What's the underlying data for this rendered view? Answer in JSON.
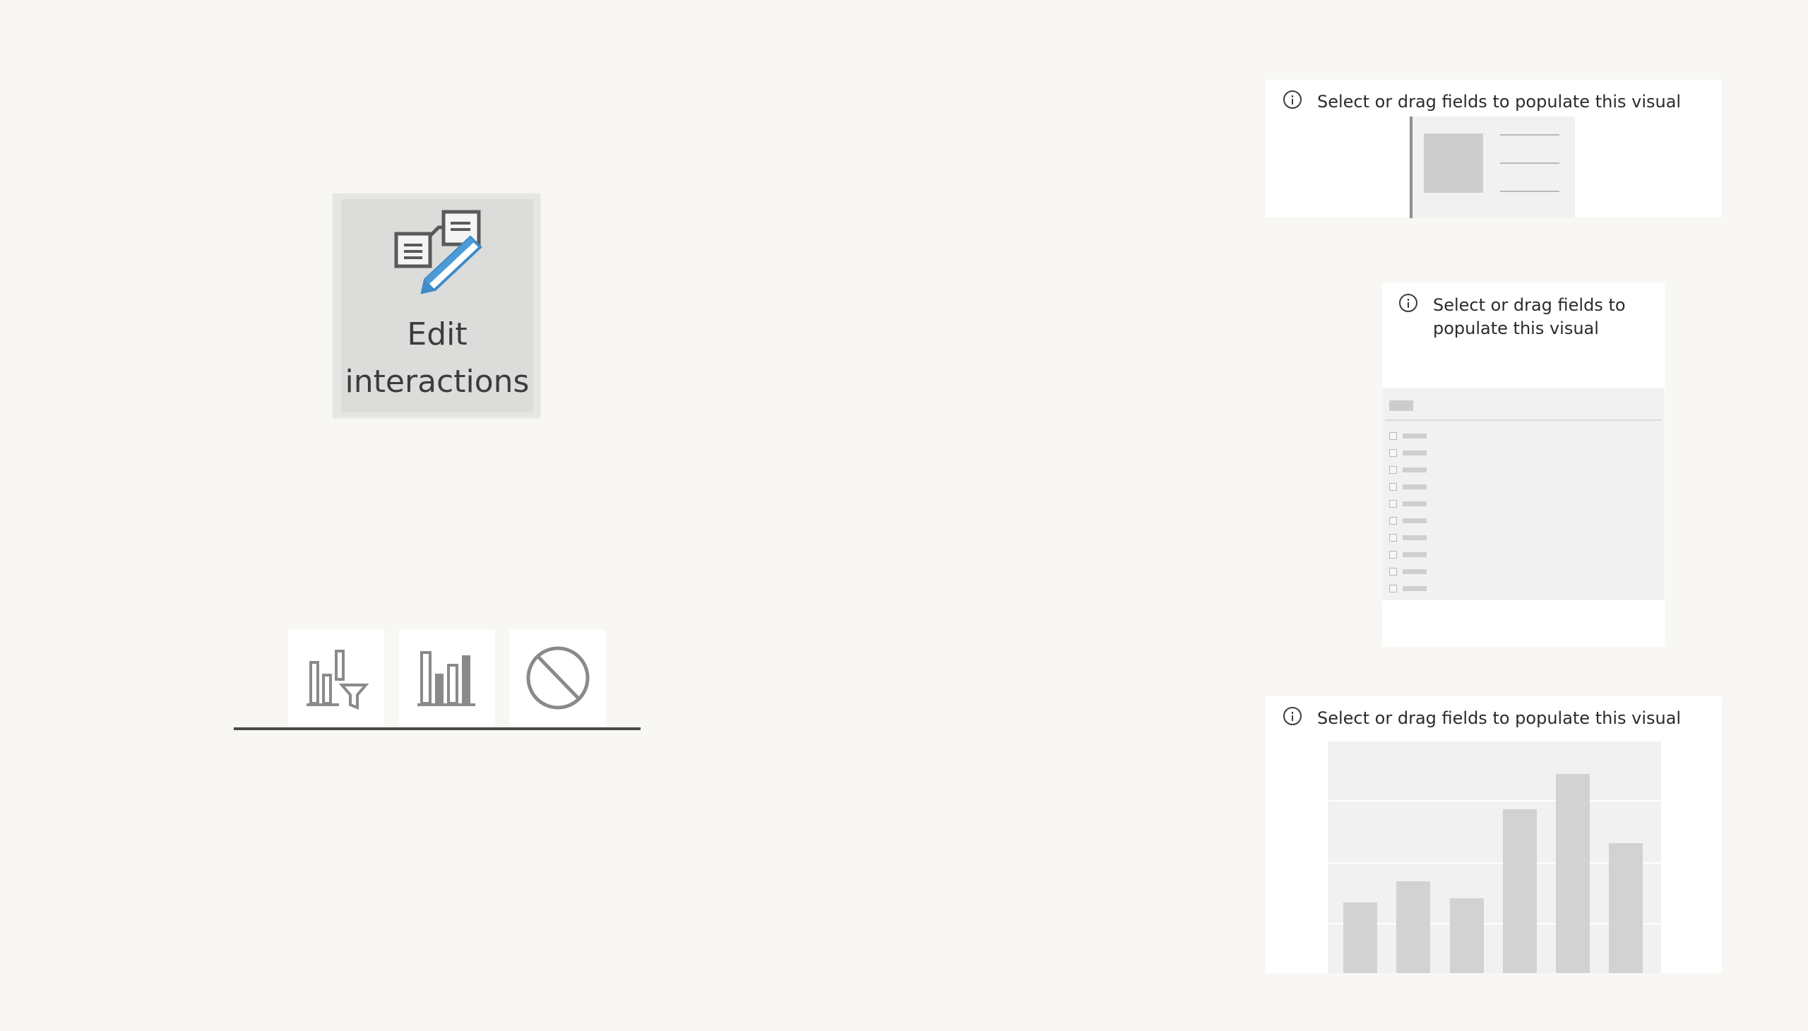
{
  "ribbon": {
    "edit_interactions": {
      "line1": "Edit",
      "line2": "interactions",
      "icon": "edit-interactions-icon",
      "accent": "#4a9bd6"
    }
  },
  "interaction_options": [
    {
      "icon": "filter-icon"
    },
    {
      "icon": "highlight-icon"
    },
    {
      "icon": "none-icon"
    }
  ],
  "visuals": {
    "card": {
      "message": "Select or drag fields to populate this visual"
    },
    "slicer": {
      "message_line1": "Select or drag fields to",
      "message_line2": "populate this visual"
    },
    "column_chart": {
      "message": "Select or drag fields to populate this visual"
    }
  },
  "placeholder_colors": {
    "fill": "#cdcdcd",
    "background": "#f1f1f1"
  }
}
